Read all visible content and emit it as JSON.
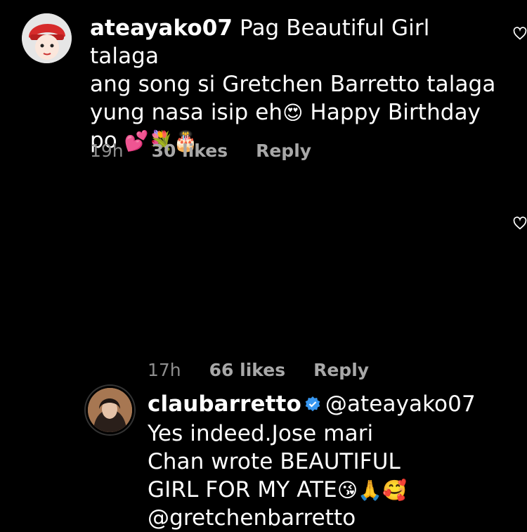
{
  "comments": [
    {
      "username": "ateayako07",
      "text_line1": "Pag Beautiful Girl talaga",
      "text_line2": "ang song si Gretchen Barretto talaga",
      "text_line3a": "yung nasa isip eh",
      "text_line3b": "Happy Birthday",
      "text_line4": "po",
      "emojis": {
        "heart_eyes": "😍",
        "two_hearts": "💕",
        "bouquet": "💐",
        "cake": "🎂"
      },
      "time": "19h",
      "likes": "30 likes",
      "reply_label": "Reply"
    },
    {
      "username": "claubarretto",
      "mention": "@ateayako07",
      "line1": "Yes indeed.Jose mari",
      "line2": "Chan wrote BEAUTIFUL",
      "line3": "GIRL FOR MY ATE",
      "line4": "@gretchenbarretto",
      "emojis": {
        "kiss": "😘",
        "pray": "🙏",
        "smiling_hearts": "🥰"
      },
      "time": "17h",
      "likes": "66 likes",
      "reply_label": "Reply"
    }
  ]
}
